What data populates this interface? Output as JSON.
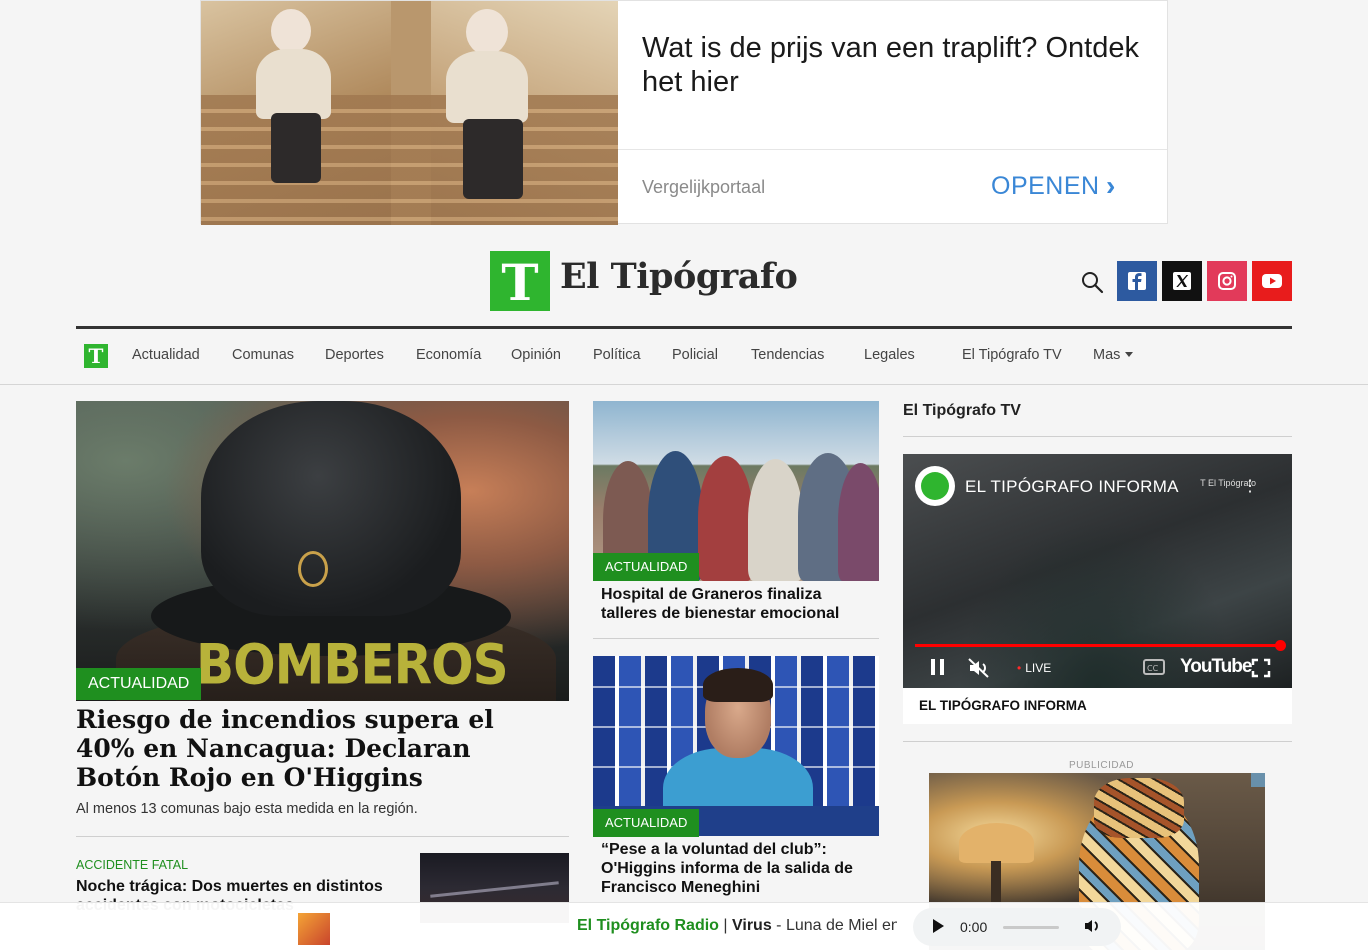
{
  "ad": {
    "headline": "Wat is de prijs van een traplift? Ontdek het hier",
    "source": "Vergelijkportaal",
    "cta": "OPENEN",
    "cta_chevron": "›"
  },
  "header": {
    "logo_mark": "T",
    "logo_text": "El Tipógrafo",
    "social": [
      "facebook-icon",
      "x-icon",
      "instagram-icon",
      "youtube-icon"
    ]
  },
  "nav": {
    "logo_mark": "T",
    "items": [
      "Actualidad",
      "Comunas",
      "Deportes",
      "Economía",
      "Opinión",
      "Política",
      "Policial",
      "Tendencias",
      "Legales",
      "El Tipógrafo TV",
      "Mas"
    ]
  },
  "hero": {
    "image_text": "BOMBEROS",
    "tag": "ACTUALIDAD",
    "title": "Riesgo de incendios supera el 40% en Nancagua: Declaran Botón Rojo en O'Higgins",
    "subtitle": "Al menos 13 comunas bajo esta medida en la región."
  },
  "small_story": {
    "category": "ACCIDENTE FATAL",
    "title": "Noche trágica: Dos muertes en distintos accidentes con motocicletas"
  },
  "middle": {
    "story1": {
      "tag": "ACTUALIDAD",
      "title": "Hospital de Graneros finaliza talleres de bienestar emocional"
    },
    "story2": {
      "tag": "ACTUALIDAD",
      "title": "“Pese a la voluntad del club”: O'Higgins informa de la salida de Francisco Meneghini"
    }
  },
  "tv": {
    "section_label": "El Tipógrafo TV",
    "video_title": "EL TIPÓGRAFO INFORMA",
    "video_watermark": "T El Tipógrafo",
    "live_label": "LIVE",
    "youtube_label": "YouTube",
    "caption": "EL TIPÓGRAFO INFORMA",
    "progress": 1.0
  },
  "publicidad": {
    "label": "PUBLICIDAD"
  },
  "radio": {
    "brand": "El Tipógrafo Radio",
    "separator": " | ",
    "artist": "Virus",
    "dash": " - ",
    "song": "Luna de Miel en la",
    "time": "0:00",
    "progress": 0.0
  },
  "colors": {
    "brand_green": "#2fb52f",
    "tag_green": "#1f8f1f",
    "ad_blue": "#3a87d6"
  }
}
